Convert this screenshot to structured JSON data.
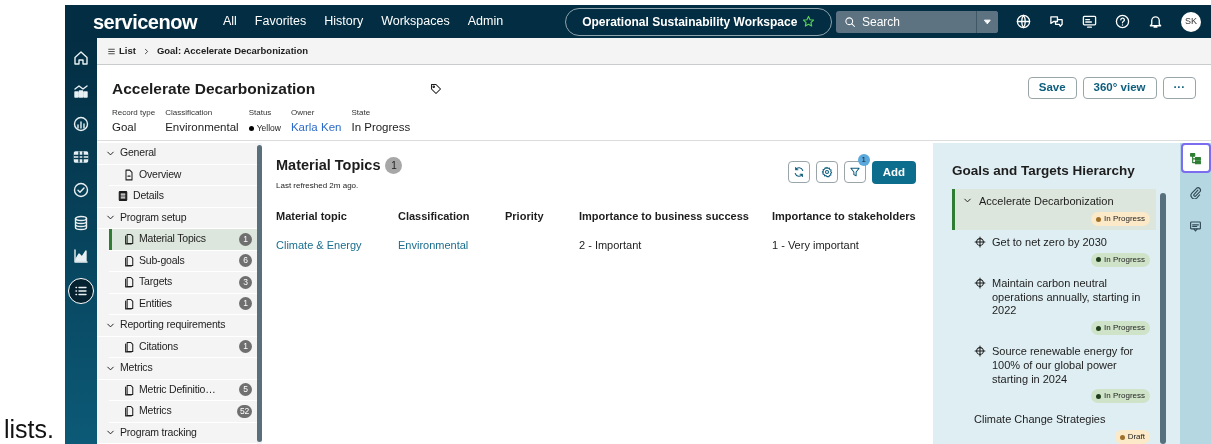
{
  "document_text": "lists.",
  "topbar": {
    "brand": "servicenow",
    "nav": [
      "All",
      "Favorites",
      "History",
      "Workspaces",
      "Admin"
    ],
    "workspace": {
      "label": "Operational Sustainability Workspace",
      "favorite": true
    },
    "search": {
      "placeholder": "Search"
    },
    "icons": [
      {
        "kind": "globe"
      },
      {
        "kind": "chat"
      },
      {
        "kind": "screen"
      },
      {
        "kind": "help"
      },
      {
        "kind": "bell"
      }
    ],
    "avatar": "SK"
  },
  "left_rail": [
    {
      "kind": "home",
      "selected": false
    },
    {
      "kind": "bars",
      "selected": false
    },
    {
      "kind": "gauge",
      "selected": false
    },
    {
      "kind": "table",
      "selected": false
    },
    {
      "kind": "check",
      "selected": false
    },
    {
      "kind": "database",
      "selected": false
    },
    {
      "kind": "linechart",
      "selected": false
    },
    {
      "kind": "list",
      "selected": true
    }
  ],
  "breadcrumb": {
    "list": "List",
    "current": "Goal: Accelerate Decarbonization"
  },
  "record": {
    "title": "Accelerate Decarbonization",
    "fields": [
      {
        "label": "Record type",
        "value": "Goal",
        "kind": "text"
      },
      {
        "label": "Classification",
        "value": "Environmental",
        "kind": "text"
      },
      {
        "label": "Status",
        "value": "Yellow",
        "kind": "status"
      },
      {
        "label": "Owner",
        "value": "Karla Ken",
        "kind": "link"
      },
      {
        "label": "State",
        "value": "In Progress",
        "kind": "text"
      }
    ],
    "buttons": [
      "Save",
      "360° view",
      "···"
    ]
  },
  "tree": [
    {
      "label": "General",
      "kind": "group",
      "expanded": true,
      "children": [
        {
          "label": "Overview",
          "kind": "page",
          "selected": false
        }
      ]
    },
    {
      "label": "Details",
      "kind": "record",
      "selected": false
    },
    {
      "label": "Program setup",
      "kind": "group",
      "expanded": true,
      "children": [
        {
          "label": "Material Topics",
          "kind": "related",
          "count": "1",
          "selected": true
        },
        {
          "label": "Sub-goals",
          "kind": "related",
          "count": "6",
          "selected": false
        },
        {
          "label": "Targets",
          "kind": "related",
          "count": "3",
          "selected": false
        },
        {
          "label": "Entities",
          "kind": "related",
          "count": "1",
          "selected": false
        }
      ]
    },
    {
      "label": "Reporting requirements",
      "kind": "group",
      "expanded": true,
      "children": [
        {
          "label": "Citations",
          "kind": "related",
          "count": "1",
          "selected": false
        }
      ]
    },
    {
      "label": "Metrics",
      "kind": "group",
      "expanded": true,
      "children": [
        {
          "label": "Metric Definitio…",
          "kind": "related",
          "count": "5",
          "selected": false
        },
        {
          "label": "Metrics",
          "kind": "related",
          "count": "52",
          "selected": false
        }
      ]
    },
    {
      "label": "Program tracking",
      "kind": "group",
      "expanded": true
    }
  ],
  "list": {
    "title": "Material Topics",
    "count": "1",
    "refreshed": "Last refreshed 2m ago.",
    "filter_count": "1",
    "add": "Add",
    "columns": [
      "Material topic",
      "Classification",
      "Priority",
      "Importance to business success",
      "Importance to stakeholders"
    ],
    "rows": [
      [
        {
          "text": "Climate & Energy",
          "kind": "link"
        },
        {
          "text": "Environmental",
          "kind": "link"
        },
        null,
        {
          "text": "2 - Important",
          "kind": "text"
        },
        {
          "text": "1 - Very important",
          "kind": "text"
        }
      ]
    ]
  },
  "hierarchy": {
    "title": "Goals and Targets Hierarchy",
    "items": [
      {
        "label": "Accelerate Decarbonization",
        "kind": "goal",
        "expanded": true,
        "selected": true,
        "status": "In Progress",
        "color": "#a0702a",
        "children": [
          {
            "label": "Get to net zero by 2030",
            "kind": "target",
            "status": "In Progress",
            "color": "#1f3d1a"
          },
          {
            "label": "Maintain carbon neutral operations annually, starting in 2022",
            "kind": "target",
            "status": "In Progress",
            "color": "#1f3d1a"
          },
          {
            "label": "Source renewable energy for 100% of our global power starting in 2024",
            "kind": "target",
            "status": "In Progress",
            "color": "#1f3d1a"
          },
          {
            "label": "Climate Change Strategies",
            "kind": "goal",
            "status": "Draft",
            "color": "#a0702a"
          }
        ]
      }
    ]
  },
  "right_rail": [
    {
      "kind": "hierarchy",
      "selected": true
    },
    {
      "kind": "attachment",
      "selected": false
    },
    {
      "kind": "comment",
      "selected": false
    }
  ]
}
